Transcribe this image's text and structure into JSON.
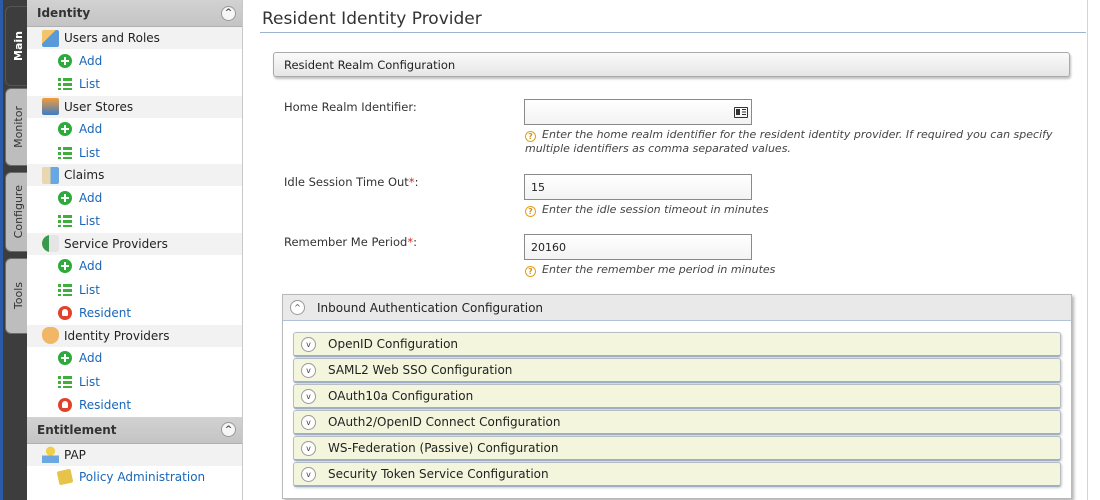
{
  "tabs": [
    {
      "label": "Main",
      "active": true
    },
    {
      "label": "Monitor",
      "active": false
    },
    {
      "label": "Configure",
      "active": false
    },
    {
      "label": "Tools",
      "active": false
    }
  ],
  "menu": {
    "identity": {
      "title": "Identity",
      "groups": [
        {
          "label": "Users and Roles",
          "icon": "users-roles-icon",
          "items": [
            {
              "label": "Add",
              "icon": "add-icon"
            },
            {
              "label": "List",
              "icon": "list-icon"
            }
          ]
        },
        {
          "label": "User Stores",
          "icon": "user-stores-icon",
          "items": [
            {
              "label": "Add",
              "icon": "add-icon"
            },
            {
              "label": "List",
              "icon": "list-icon"
            }
          ]
        },
        {
          "label": "Claims",
          "icon": "claims-icon",
          "items": [
            {
              "label": "Add",
              "icon": "add-icon"
            },
            {
              "label": "List",
              "icon": "list-icon"
            }
          ]
        },
        {
          "label": "Service Providers",
          "icon": "service-providers-icon",
          "items": [
            {
              "label": "Add",
              "icon": "add-icon"
            },
            {
              "label": "List",
              "icon": "list-icon"
            },
            {
              "label": "Resident",
              "icon": "resident-icon"
            }
          ]
        },
        {
          "label": "Identity Providers",
          "icon": "identity-providers-icon",
          "items": [
            {
              "label": "Add",
              "icon": "add-icon"
            },
            {
              "label": "List",
              "icon": "list-icon"
            },
            {
              "label": "Resident",
              "icon": "resident-icon"
            }
          ]
        }
      ]
    },
    "entitlement": {
      "title": "Entitlement",
      "groups": [
        {
          "label": "PAP",
          "icon": "pap-icon",
          "items": [
            {
              "label": "Policy Administration",
              "icon": "policy-icon"
            }
          ]
        }
      ]
    }
  },
  "page": {
    "title": "Resident Identity Provider",
    "realm_section": "Resident Realm Configuration",
    "fields": {
      "home_realm": {
        "label": "Home Realm Identifier:",
        "value": "",
        "hint": "Enter the home realm identifier for the resident identity provider. If required you can specify multiple identifiers as comma separated values."
      },
      "idle_timeout": {
        "label": "Idle Session Time Out",
        "required": "*",
        "colon": ":",
        "value": "15",
        "hint": "Enter the idle session timeout in minutes"
      },
      "remember_me": {
        "label": "Remember Me Period",
        "required": "*",
        "colon": ":",
        "value": "20160",
        "hint": "Enter the remember me period in minutes"
      }
    },
    "inbound": {
      "title": "Inbound Authentication Configuration",
      "sections": [
        "OpenID Configuration",
        "SAML2 Web SSO Configuration",
        "OAuth10a Configuration",
        "OAuth2/OpenID Connect Configuration",
        "WS-Federation (Passive) Configuration",
        "Security Token Service Configuration"
      ]
    }
  },
  "glyphs": {
    "collapse": "^",
    "expand": "v",
    "help": "?"
  }
}
